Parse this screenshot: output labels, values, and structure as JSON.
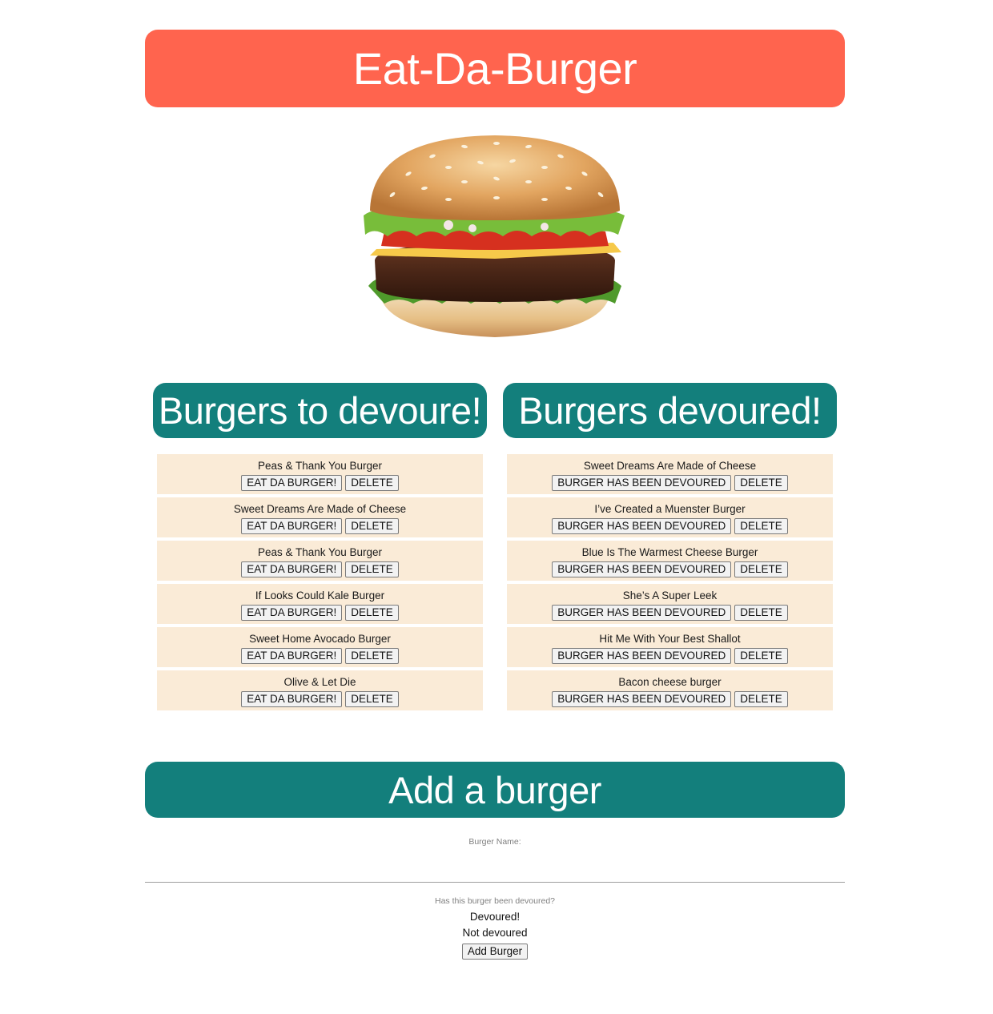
{
  "header": {
    "title": "Eat-Da-Burger"
  },
  "hero": {
    "image": "burger-image"
  },
  "to_devour": {
    "heading": "Burgers to devoure!",
    "items": [
      {
        "name": "Peas & Thank You Burger",
        "action": "EAT DA BURGER!",
        "delete": "DELETE"
      },
      {
        "name": "Sweet Dreams Are Made of Cheese",
        "action": "EAT DA BURGER!",
        "delete": "DELETE"
      },
      {
        "name": "Peas & Thank You Burger",
        "action": "EAT DA BURGER!",
        "delete": "DELETE"
      },
      {
        "name": "If Looks Could Kale Burger",
        "action": "EAT DA BURGER!",
        "delete": "DELETE"
      },
      {
        "name": "Sweet Home Avocado Burger",
        "action": "EAT DA BURGER!",
        "delete": "DELETE"
      },
      {
        "name": "Olive & Let Die",
        "action": "EAT DA BURGER!",
        "delete": "DELETE"
      }
    ]
  },
  "devoured": {
    "heading": "Burgers devoured!",
    "items": [
      {
        "name": "Sweet Dreams Are Made of Cheese",
        "action": "BURGER HAS BEEN DEVOURED",
        "delete": "DELETE"
      },
      {
        "name": "I’ve Created a Muenster Burger",
        "action": "BURGER HAS BEEN DEVOURED",
        "delete": "DELETE"
      },
      {
        "name": "Blue Is The Warmest Cheese Burger",
        "action": "BURGER HAS BEEN DEVOURED",
        "delete": "DELETE"
      },
      {
        "name": "She’s A Super Leek",
        "action": "BURGER HAS BEEN DEVOURED",
        "delete": "DELETE"
      },
      {
        "name": "Hit Me With Your Best Shallot",
        "action": "BURGER HAS BEEN DEVOURED",
        "delete": "DELETE"
      },
      {
        "name": "Bacon cheese burger",
        "action": "BURGER HAS BEEN DEVOURED",
        "delete": "DELETE"
      }
    ]
  },
  "add_form": {
    "heading": "Add a burger",
    "name_label": "Burger Name:",
    "name_value": "",
    "devoured_question": "Has this burger been devoured?",
    "option_devoured": "Devoured!",
    "option_not_devoured": "Not devoured",
    "submit_label": "Add Burger"
  },
  "colors": {
    "title_bg": "#ff644e",
    "section_bg": "#137f7c",
    "item_bg": "#faebd7"
  }
}
